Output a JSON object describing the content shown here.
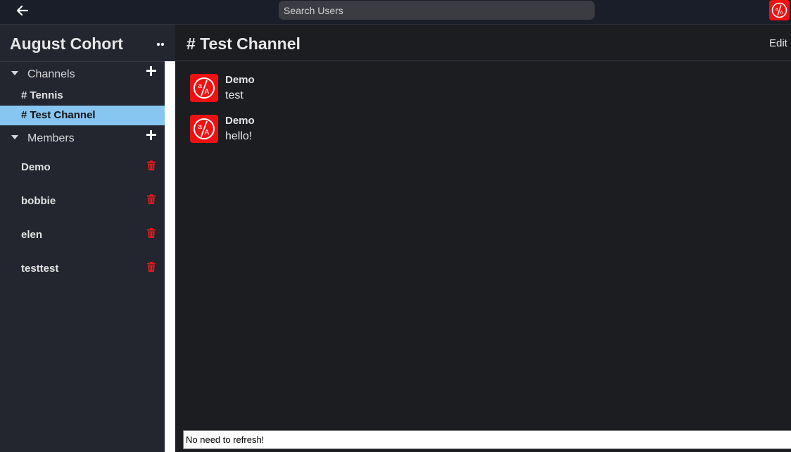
{
  "topbar": {
    "search_placeholder": "Search Users",
    "logo_text": "a/A",
    "accent_color": "#ee1111"
  },
  "sidebar": {
    "workspace_title": "August Cohort",
    "channels_label": "Channels",
    "channels": [
      {
        "label": "# Tennis",
        "active": false
      },
      {
        "label": "# Test Channel",
        "active": true
      }
    ],
    "members_label": "Members",
    "members": [
      {
        "name": "Demo"
      },
      {
        "name": "bobbie"
      },
      {
        "name": "elen"
      },
      {
        "name": "testtest"
      }
    ]
  },
  "main": {
    "channel_title": "# Test Channel",
    "edit_label": "Edit",
    "messages": [
      {
        "author": "Demo",
        "text": "test"
      },
      {
        "author": "Demo",
        "text": "hello!"
      }
    ],
    "composer_value": "No need to refresh!"
  },
  "icons": {
    "back": "arrow-left-icon",
    "more": "more-horizontal-icon",
    "add": "plus-icon",
    "delete": "trash-icon",
    "expand": "caret-down-icon"
  }
}
